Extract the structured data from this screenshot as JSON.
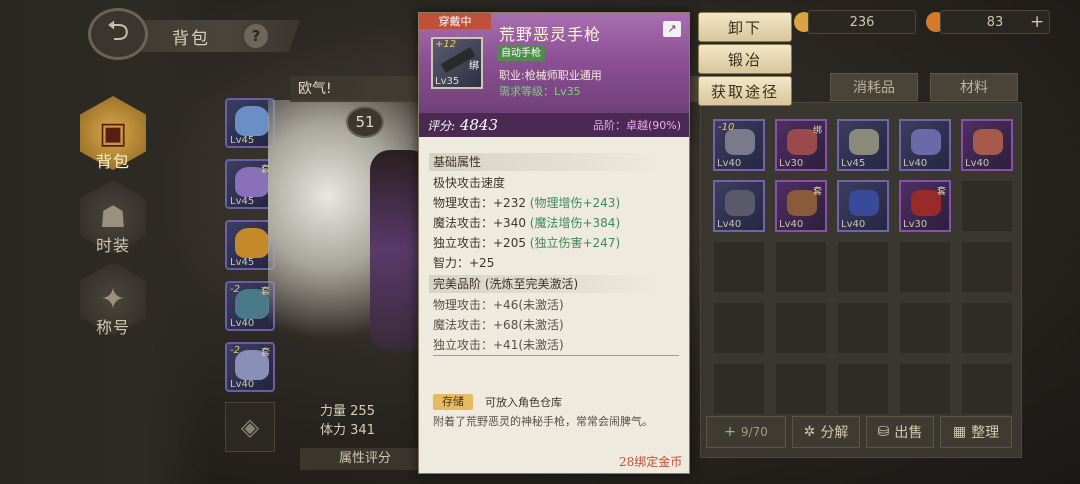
{
  "left_nav": {
    "title": "背包",
    "help": "?",
    "items": [
      {
        "label": "背包",
        "icon": "backpack-icon"
      },
      {
        "label": "时装",
        "icon": "mask-icon"
      },
      {
        "label": "称号",
        "icon": "emblem-icon"
      }
    ]
  },
  "equipment_slots": [
    {
      "level": "Lv45",
      "color": "#6a8fc7"
    },
    {
      "level": "Lv45",
      "color": "#8a6fb9",
      "tag": "套"
    },
    {
      "level": "Lv45",
      "color": "#c48a2a"
    },
    {
      "level": "Lv40",
      "color": "#4a7a8a",
      "tag": "套",
      "enhance": "-2"
    },
    {
      "level": "Lv40",
      "color": "#8a8fb8",
      "tag": "套",
      "enhance": "-2"
    }
  ],
  "character": {
    "level": "51",
    "stats": [
      {
        "label": "力量",
        "value": "255"
      },
      {
        "label": "体力",
        "value": "341"
      }
    ],
    "attr_score_label": "属性评分"
  },
  "banner_text": "欧气!",
  "currency": [
    {
      "value": "236",
      "color": "#d9a441"
    },
    {
      "value": "83",
      "color": "#d47a2a"
    }
  ],
  "tabs": [
    "消耗品",
    "材料"
  ],
  "inventory": {
    "items": [
      {
        "level": "Lv40",
        "enhance": "-10",
        "kind": "item",
        "color": "#7a7a8a"
      },
      {
        "level": "Lv30",
        "tag": "绑",
        "kind": "purple",
        "color": "#9a4a4a"
      },
      {
        "level": "Lv45",
        "kind": "item",
        "color": "#8a8a7a"
      },
      {
        "level": "Lv40",
        "kind": "item",
        "color": "#6a6aa8"
      },
      {
        "level": "Lv40",
        "kind": "purple",
        "color": "#a85a4a"
      },
      {
        "level": "Lv40",
        "kind": "item",
        "color": "#5a5a6a"
      },
      {
        "level": "Lv40",
        "tag": "套",
        "kind": "purple",
        "color": "#8a5a3a"
      },
      {
        "level": "Lv40",
        "kind": "item",
        "color": "#3a4a9a"
      },
      {
        "level": "Lv30",
        "tag": "套",
        "kind": "purple",
        "color": "#9a2a2a"
      }
    ],
    "capacity": "9/70",
    "buttons": [
      {
        "label": "分解",
        "icon": "decompose-icon"
      },
      {
        "label": "出售",
        "icon": "sell-icon"
      },
      {
        "label": "整理",
        "icon": "sort-icon"
      }
    ]
  },
  "actions": [
    "卸下",
    "锻冶",
    "获取途径"
  ],
  "tooltip": {
    "equipped_label": "穿戴中",
    "name": "荒野恶灵手枪",
    "enhance": "+12",
    "bind": "绑",
    "icon_level": "Lv35",
    "type": "自动手枪",
    "class_req": "职业:枪械师职业通用",
    "level_req": "需求等级：Lv35",
    "score_label": "评分:",
    "score": "4843",
    "grade": "品阶：卓越(90%)",
    "base_title": "基础属性",
    "base_lines": [
      {
        "text": "极快攻击速度",
        "extra": ""
      },
      {
        "text": "物理攻击：+232",
        "extra": "(物理增伤+243)"
      },
      {
        "text": "魔法攻击：+340",
        "extra": "(魔法增伤+384)"
      },
      {
        "text": "独立攻击：+205",
        "extra": "(独立伤害+247)"
      },
      {
        "text": "智力：+25",
        "extra": ""
      }
    ],
    "perfect_title": "完美品阶 (洗炼至完美激活)",
    "perfect_lines": [
      "物理攻击：+46(未激活)",
      "魔法攻击：+68(未激活)",
      "独立攻击：+41(未激活)"
    ],
    "storage_label": "存储",
    "storage_desc": "可放入角色仓库",
    "description": "附着了荒野恶灵的神秘手枪，常常会闹脾气。",
    "price": "28绑定金币"
  }
}
